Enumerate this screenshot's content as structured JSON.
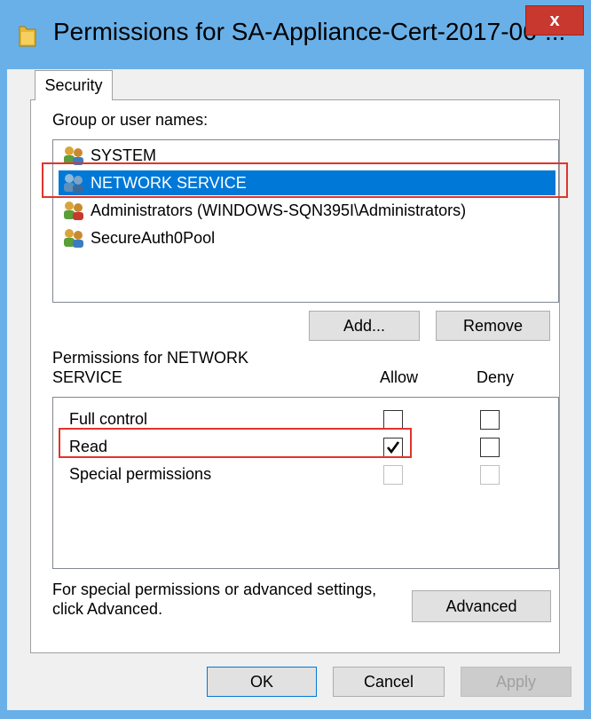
{
  "window": {
    "title": "Permissions for SA-Appliance-Cert-2017-06-...",
    "close_label": "x"
  },
  "tabs": [
    {
      "label": "Security"
    }
  ],
  "security": {
    "group_label": "Group or user names:",
    "users": [
      {
        "name": "SYSTEM",
        "selected": false
      },
      {
        "name": "NETWORK SERVICE",
        "selected": true
      },
      {
        "name": "Administrators (WINDOWS-SQN395I\\Administrators)",
        "selected": false
      },
      {
        "name": "SecureAuth0Pool",
        "selected": false
      }
    ],
    "add_label": "Add...",
    "remove_label": "Remove",
    "permissions_label_line1": "Permissions for NETWORK",
    "permissions_label_line2": "SERVICE",
    "allow_header": "Allow",
    "deny_header": "Deny",
    "permissions": [
      {
        "name": "Full control",
        "allow": false,
        "deny": false,
        "enabled": true
      },
      {
        "name": "Read",
        "allow": true,
        "deny": false,
        "enabled": true
      },
      {
        "name": "Special permissions",
        "allow": false,
        "deny": false,
        "enabled": false
      }
    ],
    "advanced_text_line1": "For special permissions or advanced settings,",
    "advanced_text_line2": "click Advanced.",
    "advanced_label": "Advanced"
  },
  "footer": {
    "ok_label": "OK",
    "cancel_label": "Cancel",
    "apply_label": "Apply"
  },
  "colors": {
    "titlebar": "#6ab0e8",
    "selection": "#0078d7",
    "highlight_box": "#e0342b",
    "close_button": "#c8382e"
  }
}
